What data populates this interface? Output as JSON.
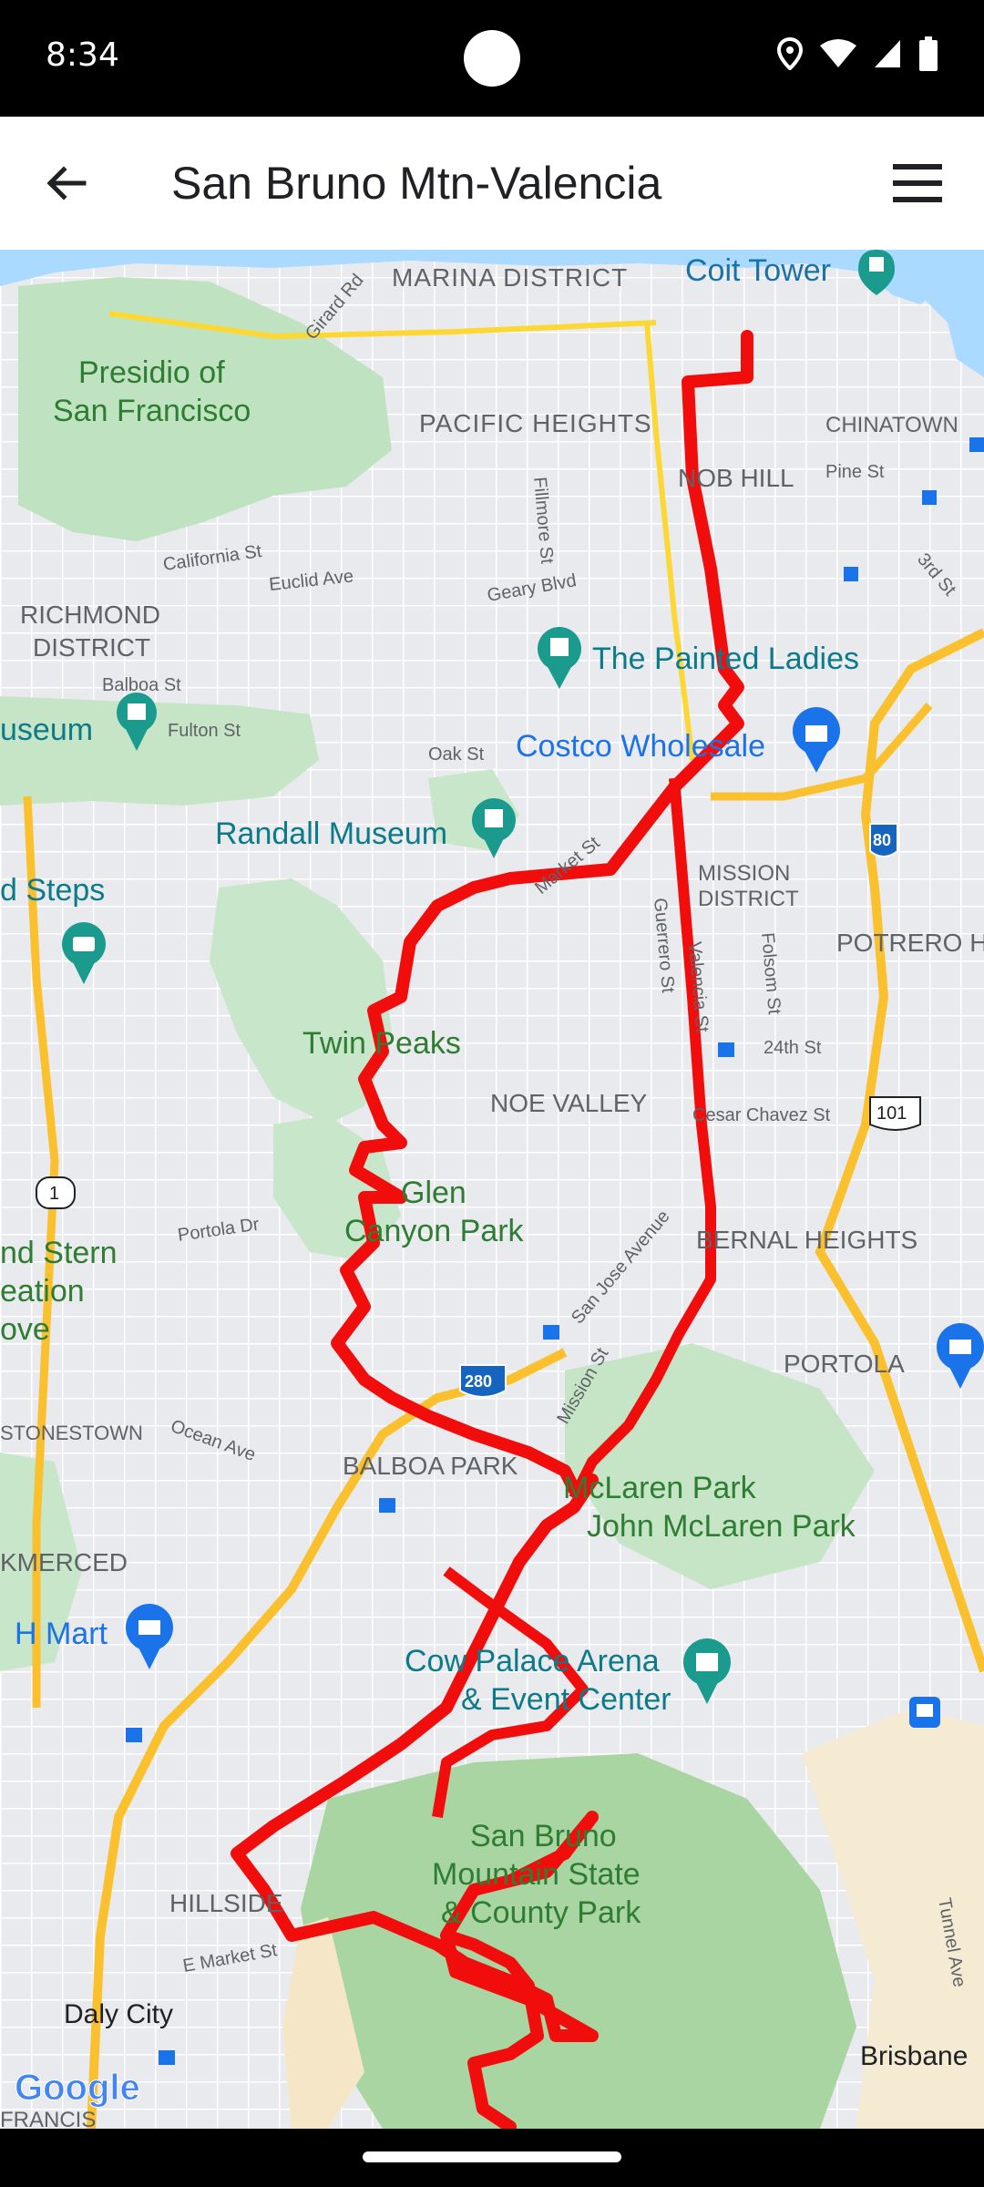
{
  "status_bar": {
    "time": "8:34",
    "icons": [
      "location-icon",
      "wifi-icon",
      "signal-icon",
      "battery-icon"
    ]
  },
  "app_bar": {
    "title": "San Bruno Mtn-Valencia",
    "back_icon": "arrow-back-icon",
    "menu_icon": "hamburger-menu-icon"
  },
  "map": {
    "districts": [
      "MARINA DISTRICT",
      "PACIFIC HEIGHTS",
      "CHINATOWN",
      "NOB HILL",
      "RICHMOND",
      "DISTRICT",
      "MISSION",
      "DISTRICT",
      "POTRERO H",
      "NOE VALLEY",
      "BERNAL HEIGHTS",
      "PORTOLA",
      "BALBOA PARK",
      "STONESTOWN",
      "KMERCED",
      "HILLSIDE"
    ],
    "places": {
      "coit_tower": "Coit Tower",
      "presidio_line1": "Presidio of",
      "presidio_line2": "San Francisco",
      "painted_ladies": "The Painted Ladies",
      "costco": "Costco Wholesale",
      "museum_partial": "useum",
      "randall_museum": "Randall Museum",
      "steps_partial": "d Steps",
      "twin_peaks": "Twin Peaks",
      "glen_line1": "Glen",
      "glen_line2": "Canyon Park",
      "stern_line1": "nd Stern",
      "stern_line2": "eation",
      "stern_line3": "ove",
      "mclaren_line1": "McLaren Park",
      "mclaren_line2": "John McLaren Park",
      "hmart": "H Mart",
      "cow_palace_line1": "Cow Palace Arena",
      "cow_palace_line2": "& Event Center",
      "sanbruno_line1": "San Bruno",
      "sanbruno_line2": "Mountain State",
      "sanbruno_line3": "& County Park",
      "daly_city": "Daly City",
      "brisbane": "Brisbane",
      "francis_partial": "FRANCIS"
    },
    "streets": {
      "girard": "Girard Rd",
      "pine": "Pine St",
      "fillmore": "Fillmore St",
      "california": "California St",
      "euclid": "Euclid Ave",
      "geary": "Geary Blvd",
      "third": "3rd St",
      "balboa": "Balboa St",
      "fulton": "Fulton St",
      "oak": "Oak St",
      "market": "Market St",
      "guerrero": "Guerrero St",
      "valencia": "Valencia St",
      "folsom": "Folsom St",
      "twentyfourth": "24th St",
      "cesar_chavez": "Cesar Chavez St",
      "portola": "Portola Dr",
      "san_jose": "San Jose Avenue",
      "mission": "Mission St",
      "ocean": "Ocean Ave",
      "e_market": "E Market St",
      "tunnel": "Tunnel Ave"
    },
    "shields": {
      "i80": "80",
      "us101": "101",
      "ca1": "1",
      "i280": "280"
    },
    "attribution": "Google",
    "route_color": "#f20d0d",
    "water_color": "#aadaff",
    "park_color": "#c8e6c9"
  }
}
